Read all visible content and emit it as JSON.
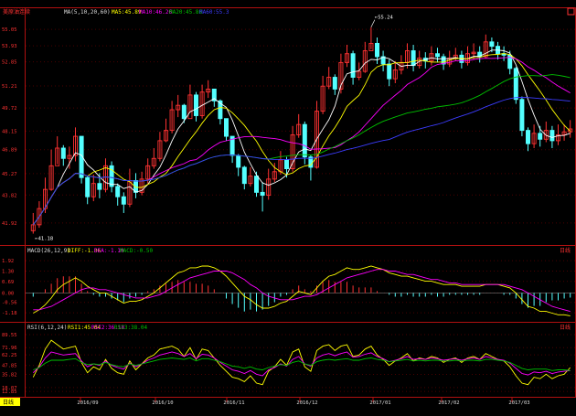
{
  "header": {
    "security_name": "美原油连续",
    "ma_label": "MA(5,10,20,60)",
    "ma5": "MA5:45.89",
    "ma10": "MA10:46.26",
    "ma20": "MA20:45.86",
    "ma60": "MA60:55.3"
  },
  "macd_header": {
    "label": "MACD(26,12,9)",
    "diff": "DIFF:-1.36",
    "dea": "DEA:-1.10",
    "macd": "MACD:-0.50",
    "period_tag": "日线"
  },
  "rsi_header": {
    "label": "RSI(6,12,24)",
    "rsi1": "RSI1:45.04",
    "rsi2": "RSI2:36.18",
    "rsi3": "RSI3:38.04",
    "period_tag": "日线"
  },
  "footer": {
    "period_button": "日线",
    "dates": [
      "2016/09",
      "2016/10",
      "2016/11",
      "2016/12",
      "2017/01",
      "2017/02",
      "2017/03"
    ]
  },
  "colors": {
    "background": "#000000",
    "up": "#ff3232",
    "down": "#54ffff",
    "ma5": "#ffffff",
    "ma10": "#ffff00",
    "ma20": "#ff00ff",
    "ma60": "#00c000",
    "ma_long": "#3c3cff",
    "axis": "#b01010",
    "text_red": "#ff3232",
    "highlight": "#ffff00"
  },
  "chart_data": [
    {
      "type": "candlestick",
      "title": "美原油连续",
      "y_ticks": [
        "55.05",
        "53.93",
        "52.85",
        "51.21",
        "49.72",
        "48.15",
        "46.89",
        "45.27",
        "43.82",
        "41.92"
      ],
      "ylim": [
        40.8,
        55.8
      ],
      "max_label": "55.24",
      "min_label": "41.18",
      "x_ticks": [
        "2016/09",
        "2016/10",
        "2016/11",
        "2016/12",
        "2017/01",
        "2017/02",
        "2017/03"
      ],
      "close": [
        41.8,
        42.9,
        44.2,
        45.8,
        47.0,
        46.3,
        46.5,
        47.8,
        45.0,
        43.7,
        44.6,
        44.2,
        45.8,
        44.4,
        43.7,
        43.2,
        44.8,
        44.0,
        44.9,
        45.8,
        46.3,
        47.5,
        48.2,
        49.6,
        49.9,
        49.0,
        50.6,
        49.2,
        50.8,
        51.0,
        50.2,
        49.0,
        47.8,
        46.5,
        45.7,
        44.6,
        45.1,
        44.0,
        43.8,
        44.9,
        45.4,
        46.2,
        45.6,
        47.9,
        48.6,
        46.4,
        45.7,
        49.5,
        51.2,
        51.8,
        51.0,
        52.8,
        53.4,
        51.8,
        52.2,
        53.6,
        54.1,
        53.2,
        52.7,
        51.7,
        52.3,
        52.8,
        53.6,
        52.6,
        53.1,
        52.9,
        53.4,
        53.2,
        52.7,
        53.1,
        53.3,
        52.8,
        53.4,
        53.5,
        53.2,
        54.2,
        53.9,
        53.4,
        53.3,
        52.4,
        50.3,
        48.2,
        47.3,
        48.0,
        47.6,
        48.2,
        47.5,
        47.9,
        48.1,
        48.3
      ],
      "high": [
        42.6,
        43.4,
        45.0,
        46.9,
        47.8,
        47.2,
        47.1,
        48.4,
        46.9,
        45.1,
        45.2,
        45.3,
        46.3,
        46.1,
        44.6,
        44.0,
        45.6,
        45.3,
        45.4,
        46.3,
        47.0,
        48.1,
        49.0,
        50.2,
        50.6,
        50.0,
        51.3,
        50.8,
        51.3,
        51.6,
        51.0,
        50.3,
        49.0,
        47.6,
        46.6,
        45.8,
        45.7,
        45.4,
        44.7,
        45.6,
        46.0,
        46.8,
        46.4,
        48.5,
        49.3,
        48.8,
        46.5,
        50.2,
        51.9,
        52.5,
        52.0,
        53.4,
        54.0,
        53.6,
        52.8,
        54.2,
        55.2,
        54.5,
        53.6,
        53.0,
        52.9,
        53.3,
        54.1,
        54.0,
        53.6,
        53.5,
        53.9,
        53.8,
        53.4,
        53.6,
        53.8,
        53.6,
        53.9,
        54.1,
        53.9,
        54.7,
        54.5,
        54.2,
        53.9,
        53.6,
        52.5,
        50.5,
        48.4,
        48.6,
        48.5,
        48.8,
        48.5,
        48.6,
        48.6,
        48.9
      ],
      "low": [
        41.2,
        41.6,
        42.6,
        44.1,
        45.9,
        45.8,
        45.6,
        46.1,
        44.6,
        43.2,
        43.4,
        43.6,
        44.0,
        44.0,
        43.1,
        42.6,
        43.0,
        43.6,
        43.8,
        44.6,
        45.6,
        46.1,
        47.4,
        48.0,
        49.1,
        48.7,
        49.4,
        48.8,
        49.0,
        50.4,
        49.8,
        48.6,
        47.5,
        46.0,
        45.1,
        44.2,
        44.4,
        43.7,
        42.7,
        43.5,
        44.7,
        45.2,
        45.0,
        45.4,
        47.7,
        45.9,
        44.8,
        45.6,
        49.3,
        51.0,
        50.6,
        50.7,
        52.5,
        51.3,
        51.6,
        52.1,
        53.7,
        52.7,
        52.2,
        51.2,
        51.4,
        52.0,
        52.4,
        52.2,
        52.4,
        52.4,
        52.6,
        52.8,
        52.3,
        52.5,
        52.9,
        52.4,
        52.6,
        53.0,
        52.8,
        53.1,
        53.5,
        53.0,
        52.9,
        52.0,
        50.0,
        47.8,
        46.8,
        47.0,
        47.1,
        47.4,
        47.0,
        47.2,
        47.5,
        47.7
      ]
    },
    {
      "type": "line",
      "title": "MACD(26,12,9)",
      "y_ticks": [
        "1.92",
        "1.30",
        "0.69",
        "0.00",
        "-0.56",
        "-1.18"
      ],
      "ylim": [
        -1.5,
        2.2
      ],
      "series": [
        {
          "name": "DIFF",
          "values": [
            -1.2,
            -1.0,
            -0.7,
            -0.3,
            0.2,
            0.5,
            0.7,
            0.9,
            0.7,
            0.4,
            0.2,
            0.0,
            0.0,
            -0.2,
            -0.4,
            -0.6,
            -0.5,
            -0.5,
            -0.4,
            -0.2,
            0.0,
            0.3,
            0.6,
            0.9,
            1.2,
            1.3,
            1.5,
            1.5,
            1.6,
            1.6,
            1.5,
            1.3,
            1.0,
            0.6,
            0.2,
            -0.2,
            -0.4,
            -0.7,
            -0.9,
            -0.9,
            -0.8,
            -0.6,
            -0.5,
            -0.2,
            0.1,
            0.0,
            -0.1,
            0.3,
            0.7,
            1.0,
            1.1,
            1.3,
            1.5,
            1.4,
            1.4,
            1.5,
            1.6,
            1.5,
            1.4,
            1.2,
            1.1,
            1.0,
            1.0,
            0.9,
            0.8,
            0.7,
            0.7,
            0.6,
            0.5,
            0.5,
            0.5,
            0.4,
            0.4,
            0.4,
            0.4,
            0.5,
            0.5,
            0.5,
            0.4,
            0.3,
            0.0,
            -0.4,
            -0.8,
            -0.9,
            -1.1,
            -1.1,
            -1.2,
            -1.3,
            -1.3,
            -1.36
          ]
        },
        {
          "name": "DEA",
          "values": [
            -1.0,
            -1.0,
            -0.9,
            -0.8,
            -0.6,
            -0.4,
            -0.2,
            0.0,
            0.2,
            0.3,
            0.3,
            0.2,
            0.2,
            0.1,
            0.0,
            -0.1,
            -0.2,
            -0.3,
            -0.3,
            -0.3,
            -0.2,
            -0.1,
            0.1,
            0.3,
            0.5,
            0.7,
            0.9,
            1.0,
            1.1,
            1.2,
            1.3,
            1.3,
            1.3,
            1.2,
            1.0,
            0.8,
            0.5,
            0.3,
            0.0,
            -0.2,
            -0.3,
            -0.4,
            -0.4,
            -0.4,
            -0.3,
            -0.2,
            -0.2,
            -0.1,
            0.1,
            0.3,
            0.5,
            0.7,
            0.9,
            1.0,
            1.1,
            1.2,
            1.3,
            1.4,
            1.4,
            1.3,
            1.3,
            1.2,
            1.1,
            1.1,
            1.0,
            0.9,
            0.8,
            0.8,
            0.7,
            0.6,
            0.6,
            0.5,
            0.5,
            0.5,
            0.5,
            0.5,
            0.5,
            0.5,
            0.5,
            0.4,
            0.3,
            0.2,
            0.0,
            -0.2,
            -0.4,
            -0.6,
            -0.8,
            -0.9,
            -1.0,
            -1.1
          ]
        },
        {
          "name": "MACD",
          "values": [
            -0.4,
            0.0,
            0.4,
            1.0,
            1.6,
            1.8,
            1.8,
            1.8,
            1.0,
            0.2,
            -0.2,
            -0.4,
            -0.4,
            -0.6,
            -0.8,
            -1.0,
            -0.6,
            -0.4,
            -0.2,
            0.2,
            0.4,
            0.8,
            1.0,
            1.2,
            1.4,
            1.2,
            1.2,
            1.0,
            1.0,
            0.8,
            0.4,
            0.0,
            -0.6,
            -1.2,
            -1.6,
            -2.0,
            -1.8,
            -2.0,
            -1.8,
            -1.4,
            -1.0,
            -0.4,
            -0.2,
            0.4,
            0.8,
            0.4,
            0.2,
            0.8,
            1.2,
            1.4,
            1.2,
            1.2,
            1.2,
            0.8,
            0.6,
            0.6,
            0.6,
            0.2,
            0.0,
            -0.2,
            -0.4,
            -0.4,
            -0.2,
            -0.4,
            -0.4,
            -0.4,
            -0.2,
            -0.4,
            -0.4,
            -0.2,
            -0.2,
            -0.2,
            -0.2,
            -0.2,
            -0.2,
            0.0,
            0.0,
            0.0,
            -0.2,
            -0.2,
            -0.6,
            -1.2,
            -1.6,
            -1.4,
            -1.4,
            -1.0,
            -0.8,
            -0.8,
            -0.6,
            -0.5
          ]
        }
      ]
    },
    {
      "type": "line",
      "title": "RSI(6,12,24)",
      "y_ticks": [
        "89.55",
        "71.96",
        "62.25",
        "47.85",
        "35.82",
        "18.07",
        "12.85"
      ],
      "ylim": [
        8,
        92
      ],
      "series": [
        {
          "name": "RSI1",
          "values": [
            32,
            48,
            70,
            82,
            76,
            70,
            72,
            74,
            52,
            38,
            46,
            42,
            56,
            44,
            38,
            36,
            54,
            42,
            50,
            58,
            62,
            70,
            72,
            74,
            70,
            60,
            72,
            56,
            70,
            68,
            58,
            48,
            40,
            32,
            30,
            26,
            34,
            24,
            22,
            40,
            46,
            56,
            48,
            66,
            70,
            46,
            40,
            68,
            74,
            76,
            68,
            74,
            76,
            60,
            62,
            70,
            74,
            62,
            56,
            48,
            54,
            58,
            64,
            54,
            58,
            56,
            60,
            58,
            52,
            56,
            58,
            52,
            58,
            60,
            56,
            64,
            60,
            56,
            54,
            46,
            34,
            24,
            22,
            32,
            30,
            36,
            30,
            34,
            36,
            45
          ]
        },
        {
          "name": "RSI2",
          "values": [
            38,
            46,
            58,
            66,
            64,
            62,
            63,
            64,
            54,
            46,
            50,
            48,
            54,
            48,
            45,
            43,
            51,
            46,
            50,
            55,
            58,
            62,
            64,
            66,
            64,
            60,
            64,
            57,
            63,
            62,
            58,
            52,
            47,
            42,
            40,
            37,
            41,
            36,
            34,
            42,
            45,
            50,
            47,
            56,
            60,
            50,
            47,
            58,
            62,
            64,
            61,
            64,
            66,
            59,
            60,
            63,
            65,
            60,
            57,
            53,
            55,
            57,
            60,
            56,
            57,
            56,
            58,
            57,
            55,
            56,
            57,
            55,
            57,
            58,
            56,
            60,
            58,
            56,
            55,
            51,
            44,
            37,
            35,
            39,
            38,
            40,
            37,
            39,
            40,
            41
          ]
        },
        {
          "name": "RSI3",
          "values": [
            42,
            45,
            51,
            55,
            55,
            55,
            56,
            57,
            52,
            49,
            50,
            49,
            52,
            49,
            47,
            46,
            50,
            48,
            50,
            52,
            54,
            56,
            57,
            58,
            57,
            56,
            58,
            54,
            57,
            57,
            55,
            53,
            50,
            47,
            46,
            44,
            46,
            43,
            42,
            45,
            47,
            49,
            48,
            52,
            54,
            50,
            48,
            53,
            55,
            56,
            55,
            56,
            57,
            55,
            55,
            57,
            58,
            56,
            55,
            53,
            54,
            55,
            56,
            54,
            55,
            54,
            55,
            55,
            54,
            54,
            55,
            54,
            55,
            55,
            54,
            56,
            56,
            55,
            54,
            52,
            48,
            44,
            42,
            43,
            43,
            43,
            41,
            42,
            42,
            41
          ]
        }
      ]
    }
  ]
}
